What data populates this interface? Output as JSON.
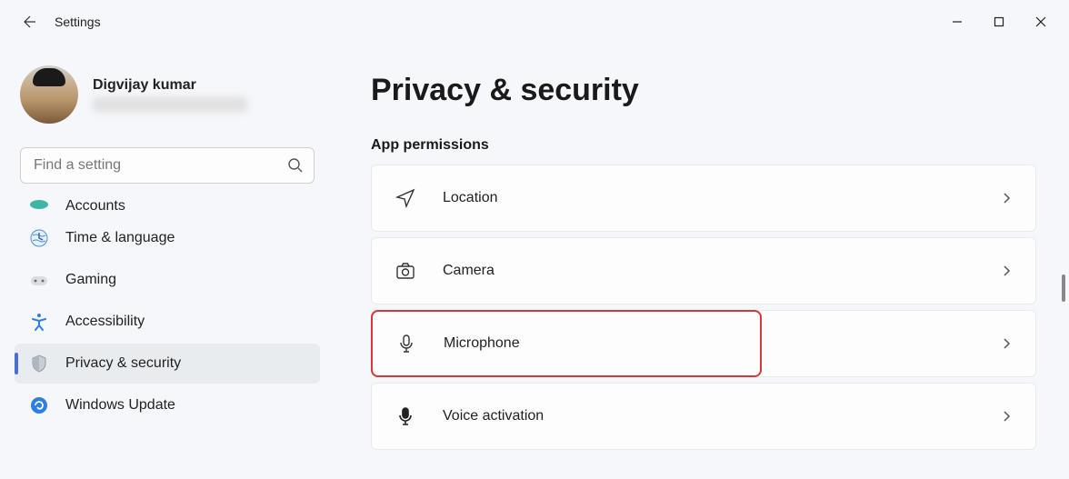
{
  "app_title": "Settings",
  "profile": {
    "name": "Digvijay kumar"
  },
  "search": {
    "placeholder": "Find a setting"
  },
  "sidebar": {
    "items": [
      {
        "label": "Accounts",
        "icon": "accounts-icon"
      },
      {
        "label": "Time & language",
        "icon": "time-icon"
      },
      {
        "label": "Gaming",
        "icon": "gaming-icon"
      },
      {
        "label": "Accessibility",
        "icon": "accessibility-icon"
      },
      {
        "label": "Privacy & security",
        "icon": "shield-icon"
      },
      {
        "label": "Windows Update",
        "icon": "update-icon"
      }
    ]
  },
  "main": {
    "title": "Privacy & security",
    "section": "App permissions",
    "cards": [
      {
        "label": "Location",
        "icon": "location-icon"
      },
      {
        "label": "Camera",
        "icon": "camera-icon"
      },
      {
        "label": "Microphone",
        "icon": "microphone-icon"
      },
      {
        "label": "Voice activation",
        "icon": "voice-icon"
      }
    ]
  }
}
